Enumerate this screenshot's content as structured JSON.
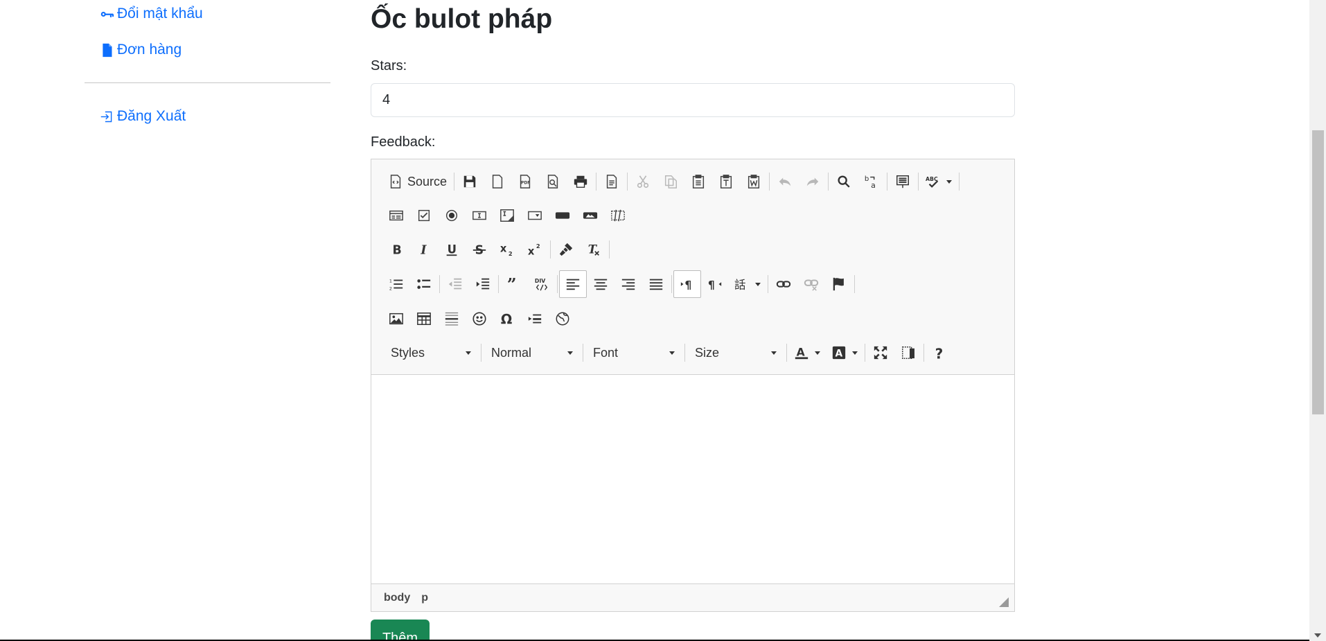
{
  "sidebar": {
    "change_password": "Đổi mật khẩu",
    "orders": "Đơn hàng",
    "logout": "Đăng Xuất"
  },
  "main": {
    "title": "Ốc bulot pháp",
    "stars_label": "Stars:",
    "stars_value": "4",
    "feedback_label": "Feedback:",
    "submit_label": "Thêm"
  },
  "editor": {
    "source_label": "Source",
    "styles_label": "Styles",
    "format_label": "Normal",
    "font_label": "Font",
    "size_label": "Size",
    "path": [
      "body",
      "p"
    ]
  },
  "colors": {
    "link": "#0d6efd",
    "submit": "#198754"
  }
}
